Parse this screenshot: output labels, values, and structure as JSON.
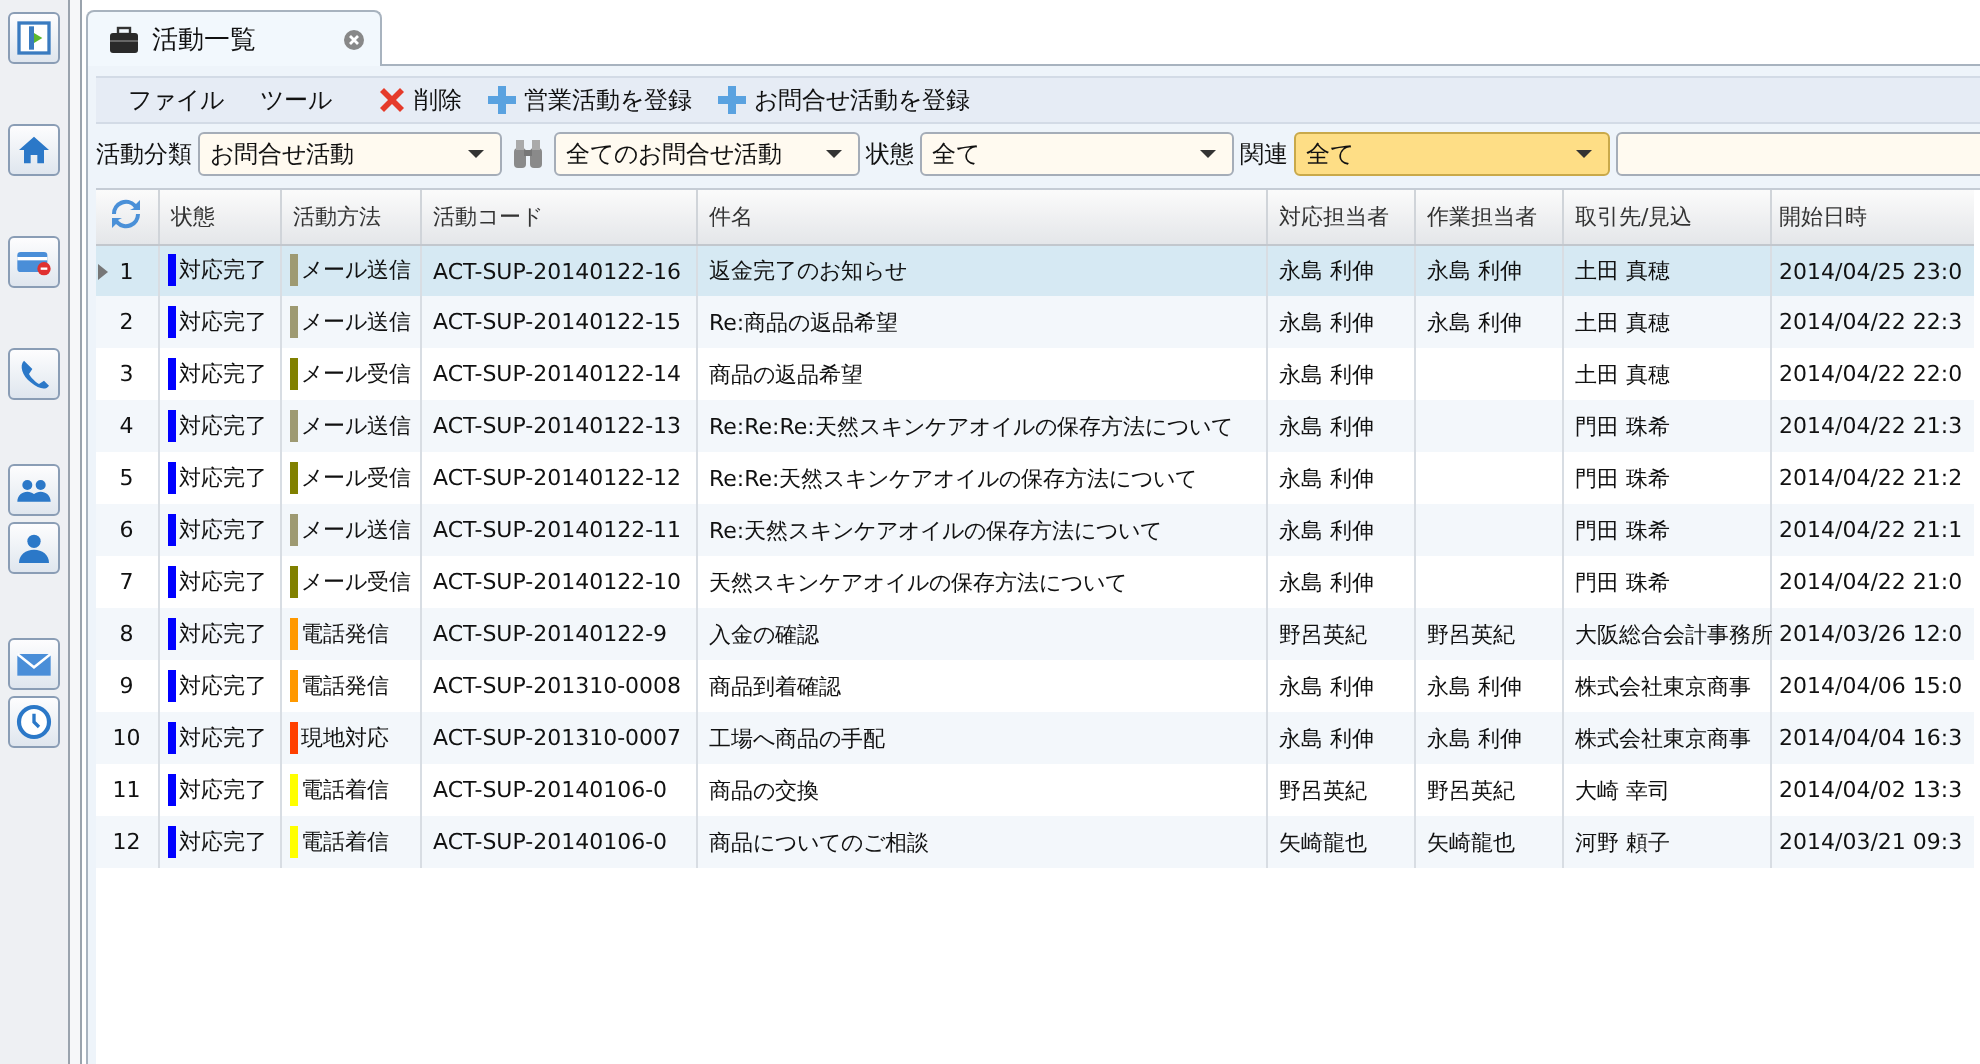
{
  "tab": {
    "title": "活動一覧",
    "selected": true
  },
  "menu": [
    "ファイル",
    "ツール"
  ],
  "toolbar": [
    {
      "kind": "delete",
      "label": "削除"
    },
    {
      "kind": "add",
      "label": "営業活動を登録"
    },
    {
      "kind": "add",
      "label": "お問合せ活動を登録"
    }
  ],
  "filters": [
    {
      "kind": "dropdown",
      "label": "活動分類",
      "value": "お問合せ活動",
      "highlighted": false
    },
    {
      "kind": "search_dropdown",
      "value": "全てのお問合せ活動",
      "highlighted": false
    },
    {
      "kind": "dropdown",
      "label": "状態",
      "value": "全て",
      "highlighted": false
    },
    {
      "kind": "dropdown",
      "label": "関連",
      "value": "全て",
      "highlighted": true
    },
    {
      "kind": "text"
    }
  ],
  "table": {
    "columns": [
      "状態",
      "活動方法",
      "活動コード",
      "件名",
      "対応担当者",
      "作業担当者",
      "取引先/見込",
      "開始日時"
    ],
    "rows": [
      {
        "no": "1",
        "status": {
          "text": "対応完了",
          "color": "#0000ff"
        },
        "method": {
          "text": "メール送信",
          "color": "#9e9a72"
        },
        "code": "ACT-SUP-20140122-16",
        "subject": "返金完了のお知らせ",
        "owner": "永島 利伸",
        "worker": "永島 利伸",
        "account": "土田 真穂",
        "start": "2014/04/25 23:0",
        "selected": true
      },
      {
        "no": "2",
        "status": {
          "text": "対応完了",
          "color": "#0000ff"
        },
        "method": {
          "text": "メール送信",
          "color": "#9e9a72"
        },
        "code": "ACT-SUP-20140122-15",
        "subject": "Re:商品の返品希望",
        "owner": "永島 利伸",
        "worker": "永島 利伸",
        "account": "土田 真穂",
        "start": "2014/04/22 22:3",
        "selected": false
      },
      {
        "no": "3",
        "status": {
          "text": "対応完了",
          "color": "#0000ff"
        },
        "method": {
          "text": "メール受信",
          "color": "#808000"
        },
        "code": "ACT-SUP-20140122-14",
        "subject": "商品の返品希望",
        "owner": "永島 利伸",
        "account": "土田 真穂",
        "start": "2014/04/22 22:0",
        "selected": false
      },
      {
        "no": "4",
        "status": {
          "text": "対応完了",
          "color": "#0000ff"
        },
        "method": {
          "text": "メール送信",
          "color": "#9e9a72"
        },
        "code": "ACT-SUP-20140122-13",
        "subject": "Re:Re:Re:天然スキンケアオイルの保存方法について",
        "owner": "永島 利伸",
        "account": "門田 珠希",
        "start": "2014/04/22 21:3",
        "selected": false
      },
      {
        "no": "5",
        "status": {
          "text": "対応完了",
          "color": "#0000ff"
        },
        "method": {
          "text": "メール受信",
          "color": "#808000"
        },
        "code": "ACT-SUP-20140122-12",
        "subject": "Re:Re:天然スキンケアオイルの保存方法について",
        "owner": "永島 利伸",
        "account": "門田 珠希",
        "start": "2014/04/22 21:2",
        "selected": false
      },
      {
        "no": "6",
        "status": {
          "text": "対応完了",
          "color": "#0000ff"
        },
        "method": {
          "text": "メール送信",
          "color": "#9e9a72"
        },
        "code": "ACT-SUP-20140122-11",
        "subject": "Re:天然スキンケアオイルの保存方法について",
        "owner": "永島 利伸",
        "account": "門田 珠希",
        "start": "2014/04/22 21:1",
        "selected": false
      },
      {
        "no": "7",
        "status": {
          "text": "対応完了",
          "color": "#0000ff"
        },
        "method": {
          "text": "メール受信",
          "color": "#808000"
        },
        "code": "ACT-SUP-20140122-10",
        "subject": "天然スキンケアオイルの保存方法について",
        "owner": "永島 利伸",
        "account": "門田 珠希",
        "start": "2014/04/22 21:0",
        "selected": false
      },
      {
        "no": "8",
        "status": {
          "text": "対応完了",
          "color": "#0000ff"
        },
        "method": {
          "text": "電話発信",
          "color": "#ff9900"
        },
        "code": "ACT-SUP-20140122-9",
        "subject": "入金の確認",
        "owner": "野呂英紀",
        "worker": "野呂英紀",
        "account": "大阪総合会計事務所",
        "start": "2014/03/26 12:0",
        "selected": false
      },
      {
        "no": "9",
        "status": {
          "text": "対応完了",
          "color": "#0000ff"
        },
        "method": {
          "text": "電話発信",
          "color": "#ff9900"
        },
        "code": "ACT-SUP-201310-0008",
        "subject": "商品到着確認",
        "owner": "永島 利伸",
        "worker": "永島 利伸",
        "account": "株式会社東京商事",
        "start": "2014/04/06 15:0",
        "selected": false
      },
      {
        "no": "10",
        "status": {
          "text": "対応完了",
          "color": "#0000ff"
        },
        "method": {
          "text": "現地対応",
          "color": "#ff4000"
        },
        "code": "ACT-SUP-201310-0007",
        "subject": "工場へ商品の手配",
        "owner": "永島 利伸",
        "worker": "永島 利伸",
        "account": "株式会社東京商事",
        "start": "2014/04/04 16:3",
        "selected": false
      },
      {
        "no": "11",
        "status": {
          "text": "対応完了",
          "color": "#0000ff"
        },
        "method": {
          "text": "電話着信",
          "color": "#ffff00"
        },
        "code": "ACT-SUP-20140106-0",
        "subject": "商品の交換",
        "owner": "野呂英紀",
        "worker": "野呂英紀",
        "account": "大崎 幸司",
        "start": "2014/04/02 13:3",
        "selected": false
      },
      {
        "no": "12",
        "status": {
          "text": "対応完了",
          "color": "#0000ff"
        },
        "method": {
          "text": "電話着信",
          "color": "#ffff00"
        },
        "code": "ACT-SUP-20140106-0",
        "subject": "商品についてのご相談",
        "owner": "矢崎龍也",
        "worker": "矢崎龍也",
        "account": "河野 頼子",
        "start": "2014/03/21 09:3",
        "selected": false
      }
    ]
  }
}
